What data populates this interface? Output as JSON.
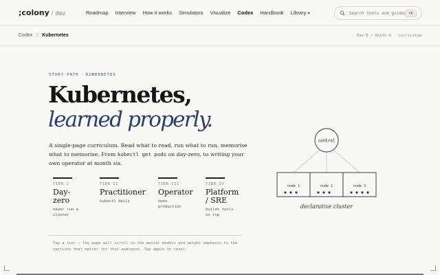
{
  "brand": {
    "logo": ";colony",
    "slash": "/",
    "sub": "dev"
  },
  "nav": {
    "items": [
      {
        "label": "Roadmap",
        "active": false
      },
      {
        "label": "Interview",
        "active": false
      },
      {
        "label": "How it works",
        "active": false
      },
      {
        "label": "Simulators",
        "active": false
      },
      {
        "label": "Visualize",
        "active": false
      },
      {
        "label": "Codex",
        "active": true
      },
      {
        "label": "Handbook",
        "active": false
      },
      {
        "label": "Library",
        "active": false
      }
    ],
    "library_caret": "▾"
  },
  "search": {
    "placeholder": "Search tools and guides",
    "shortcut": "⌘K"
  },
  "breadcrumb": {
    "root": "Codex",
    "sep": "/",
    "current": "Kubernetes",
    "right": "Day-0 → Month-6 · curriculum"
  },
  "hero": {
    "eyebrow_a": "STUDY PATH",
    "eyebrow_dot": "·",
    "eyebrow_b": "KUBERNETES",
    "title_line1": "Kubernetes,",
    "title_line2": "learned properly.",
    "lede_pre": "A single-page curriculum. Read what to read, run what to run, memorise what to memorise. From ",
    "lede_code": "kubectl get pods",
    "lede_post": " on day-zero, to writing your own operator at month six."
  },
  "tiers": [
    {
      "label": "TIER I",
      "name": "Day-zero",
      "desc": "never run a cluster"
    },
    {
      "label": "TIER II",
      "name": "Practitioner",
      "desc": "kubectl daily"
    },
    {
      "label": "TIER III",
      "name": "Operator",
      "desc": "owns production"
    },
    {
      "label": "TIER IV",
      "name": "Platform / SRE",
      "desc": "builds tools on top"
    }
  ],
  "note": "Tap a tier — the page will scroll to the mental models and weight emphasis to the sections that matter for that audience. Tap again to reset.",
  "diagram": {
    "control": "control",
    "nodes": [
      "node 1",
      "node 2",
      "node 3"
    ],
    "caption": "declarative cluster",
    "node_dots": [
      3,
      3,
      4
    ]
  },
  "colors": {
    "accent": "#2c3e6a",
    "background": "#faf8f4",
    "ink": "#1a1a1a"
  }
}
